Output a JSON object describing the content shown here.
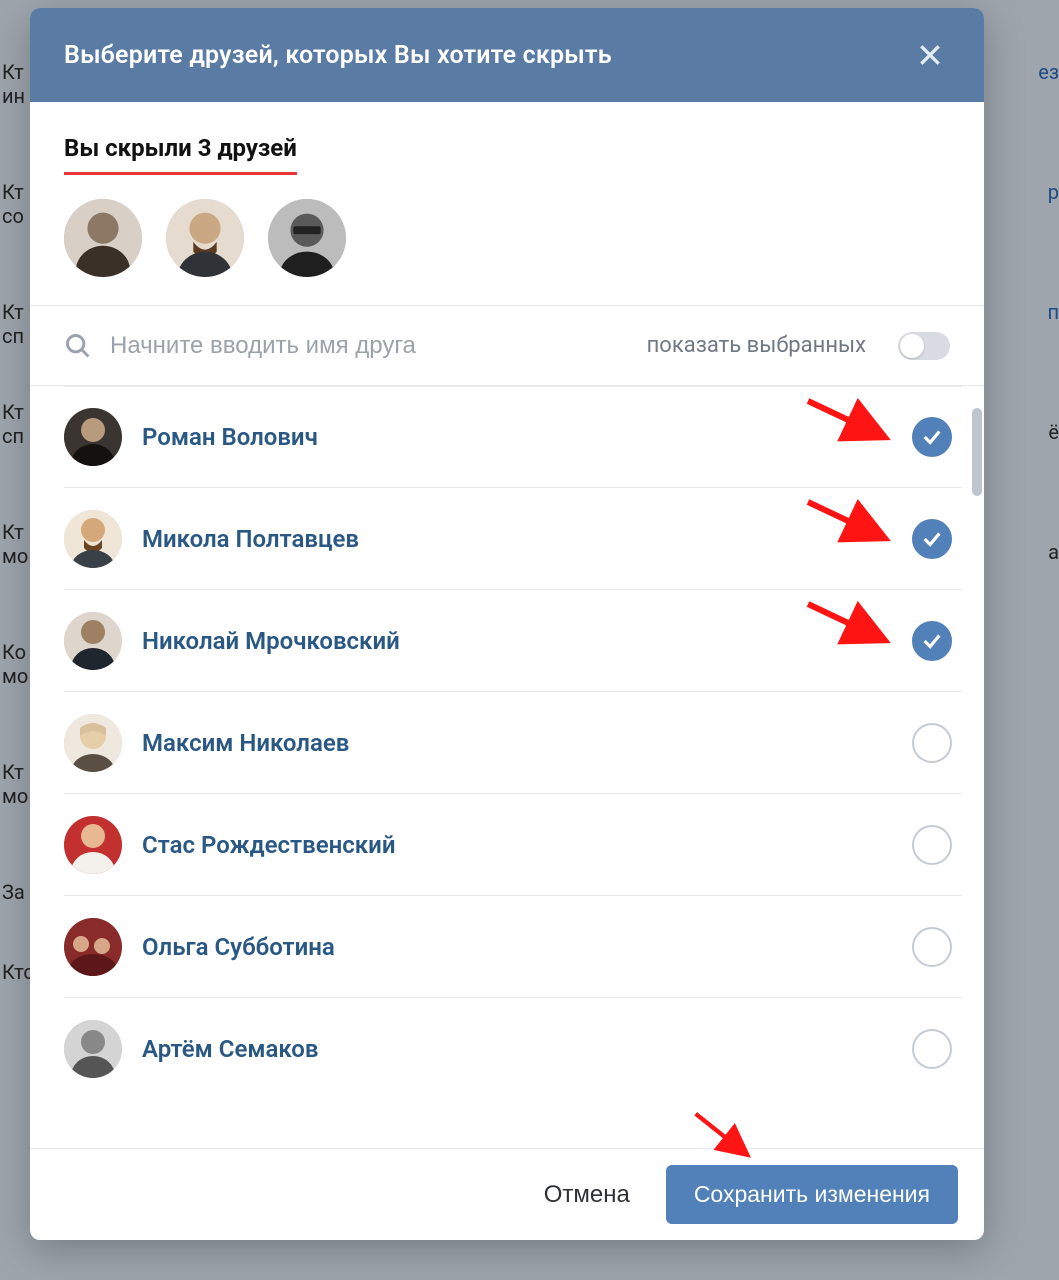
{
  "modal": {
    "title": "Выберите друзей, которых Вы хотите скрыть",
    "hidden_summary": "Вы скрыли 3 друзей"
  },
  "search": {
    "placeholder": "Начните вводить имя друга",
    "show_selected_label": "показать выбранных"
  },
  "friends": [
    {
      "name": "Роман Волович",
      "checked": true
    },
    {
      "name": "Микола Полтавцев",
      "checked": true
    },
    {
      "name": "Николай Мрочковский",
      "checked": true
    },
    {
      "name": "Максим Николаев",
      "checked": false
    },
    {
      "name": "Стас Рождественский",
      "checked": false
    },
    {
      "name": "Ольга Субботина",
      "checked": false
    },
    {
      "name": "Артём Семаков",
      "checked": false
    }
  ],
  "footer": {
    "cancel": "Отмена",
    "save": "Сохранить изменения"
  },
  "bg": {
    "l0": "Кт",
    "l1": "ин",
    "l2": "Кт",
    "l3": "со",
    "l4": "Кт",
    "l5": "сп",
    "l6": "Кт",
    "l7": "сп",
    "l8": "Кт",
    "l9": "мо",
    "l10": "Ко",
    "l11": "мо",
    "l12": "Кт",
    "l13": "мо",
    "l14": "За",
    "l15": "Кто видит чужие записи",
    "r0": "ез",
    "r1": "р",
    "r2": "п",
    "r3": "ё",
    "r4": "а"
  }
}
